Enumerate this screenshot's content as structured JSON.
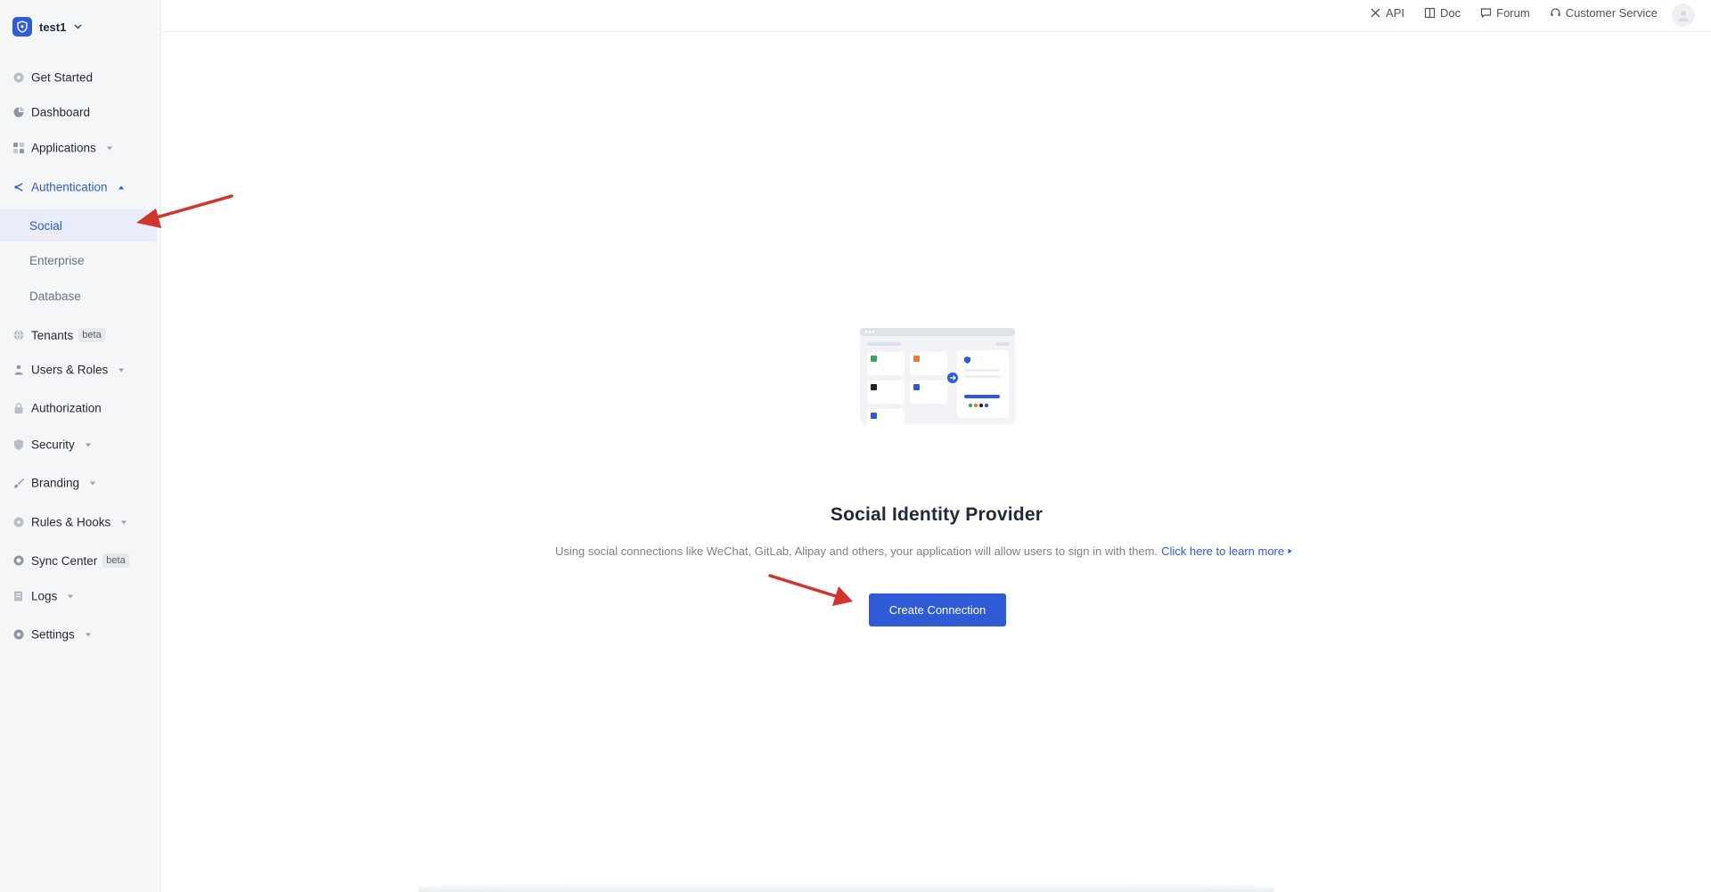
{
  "tenant": {
    "name": "test1"
  },
  "sidebar": {
    "items": [
      {
        "label": "Get Started",
        "icon": "rocket-icon"
      },
      {
        "label": "Dashboard",
        "icon": "pie-chart-icon"
      },
      {
        "label": "Applications",
        "icon": "apps-grid-icon"
      },
      {
        "label": "Authentication",
        "icon": "share-icon",
        "expanded": true
      },
      {
        "label": "Tenants",
        "icon": "globe-icon",
        "badge": "beta"
      },
      {
        "label": "Users & Roles",
        "icon": "users-icon"
      },
      {
        "label": "Authorization",
        "icon": "lock-icon"
      },
      {
        "label": "Security",
        "icon": "shield-icon"
      },
      {
        "label": "Branding",
        "icon": "brush-icon"
      },
      {
        "label": "Rules & Hooks",
        "icon": "hook-icon"
      },
      {
        "label": "Sync Center",
        "icon": "sync-icon",
        "badge": "beta"
      },
      {
        "label": "Logs",
        "icon": "log-icon"
      },
      {
        "label": "Settings",
        "icon": "gear-icon"
      }
    ],
    "auth_sub": [
      {
        "label": "Social",
        "selected": true
      },
      {
        "label": "Enterprise"
      },
      {
        "label": "Database"
      }
    ]
  },
  "topbar": {
    "links": [
      {
        "label": "API",
        "icon": "api-icon"
      },
      {
        "label": "Doc",
        "icon": "book-icon"
      },
      {
        "label": "Forum",
        "icon": "chat-icon"
      },
      {
        "label": "Customer Service",
        "icon": "headset-icon"
      }
    ]
  },
  "main": {
    "title": "Social Identity Provider",
    "description": "Using social connections like WeChat, GitLab, Alipay and others, your application will allow users to sign in with them.",
    "learn_more": "Click here to learn more",
    "create_button": "Create Connection"
  },
  "colors": {
    "accent": "#2f5bd7",
    "annotation_arrow": "#d0342c"
  }
}
